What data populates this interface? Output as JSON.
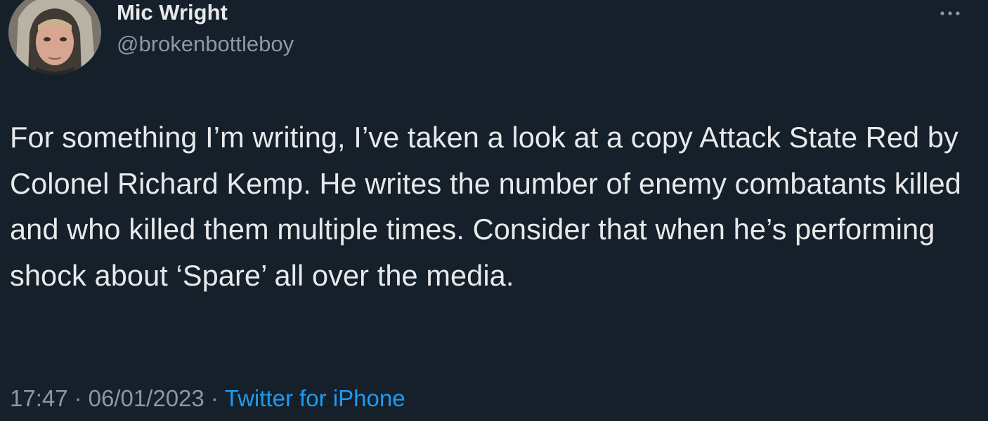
{
  "author": {
    "display_name": "Mic Wright",
    "handle": "@brokenbottleboy"
  },
  "tweet": {
    "text": "For something I’m writing, I’ve taken a look at a copy Attack State Red by Colonel Richard Kemp. He writes the number of enemy combatants killed and who killed them multiple times. Consider that when he’s performing shock about ‘Spare’ all over the media."
  },
  "meta": {
    "time": "17:47",
    "separator": "·",
    "date": "06/01/2023",
    "source": "Twitter for iPhone"
  },
  "icons": {
    "more": "more-horizontal-icon",
    "avatar": "profile-photo"
  },
  "colors": {
    "background": "#15202b",
    "primary_text": "#e7e9ea",
    "secondary_text": "#8b98a5",
    "link": "#1d9bf0"
  }
}
